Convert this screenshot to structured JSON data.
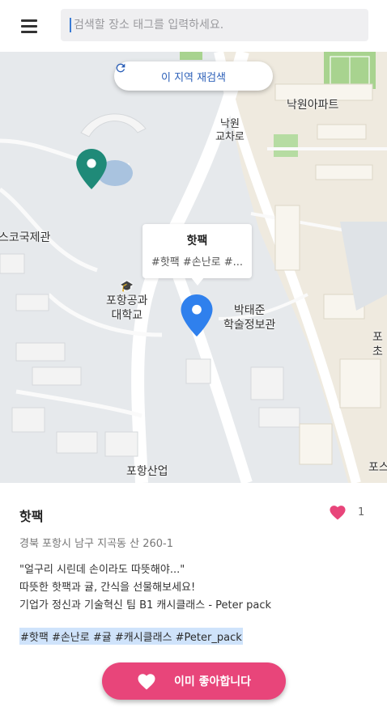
{
  "search": {
    "placeholder": "검색할 장소 태그를 입력하세요."
  },
  "map": {
    "refresh_label": "이 지역 재검색",
    "labels": {
      "nakwon_apt": "낙원아파트",
      "nakwon_intersection_1": "낙원",
      "nakwon_intersection_2": "교차로",
      "international_hall": "스코국제관",
      "postech_1": "포항공과",
      "postech_2": "대학교",
      "library_1": "박태준",
      "library_2": "학술정보관",
      "pohang_industry": "포항산업",
      "edge_1": "포",
      "edge_2": "초",
      "edge_3": "포스"
    },
    "callout": {
      "title": "핫팩",
      "tags": "#핫팩 #손난로 #..."
    },
    "colors": {
      "teal_pin": "#1f8a78",
      "blue_pin": "#2f80ed"
    }
  },
  "place": {
    "name": "핫팩",
    "like_count": "1",
    "address": "경북 포항시 남구 지곡동 산 260-1",
    "description": [
      "\"얼구리 시린데 손이라도 따뜻해야...\"",
      "따뜻한 핫팩과 귤, 간식을 선물해보세요!",
      "기업가 정신과 기술혁신 팀 B1 캐시클래스 - Peter pack"
    ],
    "tags": "#핫팩 #손난로 #귤 #캐시클래스 #Peter_pack",
    "cta_label": "이미 좋아합니다",
    "accent": "#e8457a"
  }
}
